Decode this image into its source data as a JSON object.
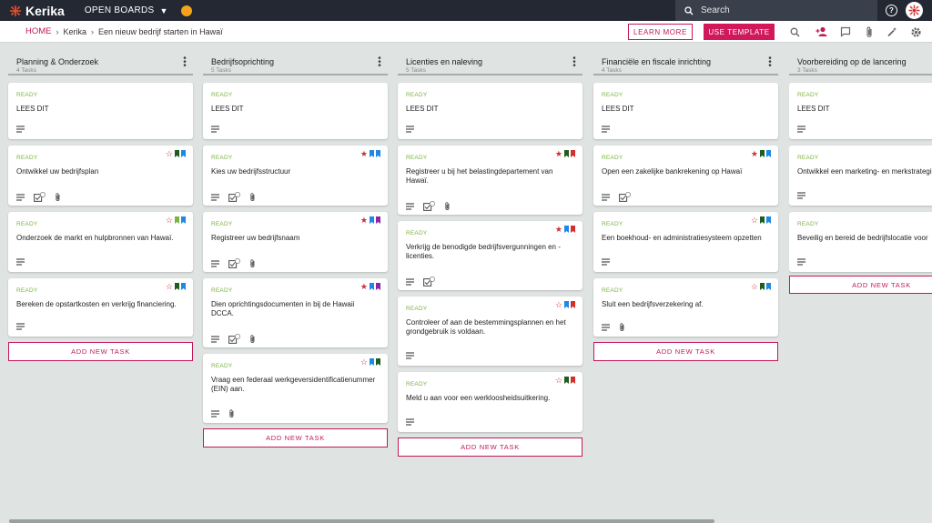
{
  "app": {
    "logo_text": "Kerika",
    "open_boards": "OPEN BOARDS"
  },
  "search": {
    "placeholder": "Search"
  },
  "help": {
    "symbol": "?"
  },
  "breadcrumb": {
    "home": "HOME",
    "kerika": "Kerika",
    "board": "Een nieuw bedrijf starten in Hawaï"
  },
  "buttons": {
    "learn_more": "LEARN MORE",
    "use_template": "USE TEMPLATE",
    "add_task": "ADD NEW TASK"
  },
  "colors": {
    "accent": "#c2185b",
    "ready": "#7cb342",
    "red": "#d32f2f",
    "green": "#1b5e20",
    "blue": "#1e88e5",
    "light_green": "#7cb342",
    "purple": "#8e24aa"
  },
  "columns": [
    {
      "title": "Planning & Onderzoek",
      "count": "4 Tasks",
      "cards": [
        {
          "status": "READY",
          "title": "LEES DIT",
          "icons": [
            "desc"
          ],
          "flags": []
        },
        {
          "status": "READY",
          "title": "Ontwikkel uw bedrijfsplan",
          "icons": [
            "desc",
            "checklist",
            "attach"
          ],
          "flags": [
            "star-outline",
            "green",
            "blue"
          ]
        },
        {
          "status": "READY",
          "title": "Onderzoek de markt en hulpbronnen van Hawaï.",
          "icons": [
            "desc"
          ],
          "flags": [
            "star-outline",
            "light_green",
            "blue"
          ]
        },
        {
          "status": "READY",
          "title": "Bereken de opstartkosten en verkrijg financiering.",
          "icons": [
            "desc"
          ],
          "flags": [
            "star-outline",
            "green",
            "blue"
          ]
        }
      ]
    },
    {
      "title": "Bedrijfsoprichting",
      "count": "5 Tasks",
      "cards": [
        {
          "status": "READY",
          "title": "LEES DIT",
          "icons": [
            "desc"
          ],
          "flags": []
        },
        {
          "status": "READY",
          "title": "Kies uw bedrijfsstructuur",
          "icons": [
            "desc",
            "checklist",
            "attach"
          ],
          "flags": [
            "star",
            "blue",
            "blue"
          ]
        },
        {
          "status": "READY",
          "title": "Registreer uw bedrijfsnaam",
          "icons": [
            "desc",
            "checklist",
            "attach"
          ],
          "flags": [
            "star",
            "blue",
            "purple"
          ]
        },
        {
          "status": "READY",
          "title": "Dien oprichtingsdocumenten in bij de Hawaii DCCA.",
          "icons": [
            "desc",
            "checklist",
            "attach"
          ],
          "flags": [
            "star",
            "blue",
            "purple"
          ]
        },
        {
          "status": "READY",
          "title": "Vraag een federaal werkgeversidentificatienummer (EIN) aan.",
          "icons": [
            "desc",
            "attach"
          ],
          "flags": [
            "star-outline",
            "blue",
            "green"
          ]
        }
      ]
    },
    {
      "title": "Licenties en naleving",
      "count": "5 Tasks",
      "cards": [
        {
          "status": "READY",
          "title": "LEES DIT",
          "icons": [
            "desc"
          ],
          "flags": []
        },
        {
          "status": "READY",
          "title": "Registreer u bij het belastingdepartement van Hawaï.",
          "icons": [
            "desc",
            "checklist",
            "attach"
          ],
          "flags": [
            "star",
            "green",
            "red"
          ]
        },
        {
          "status": "READY",
          "title": "Verkrijg de benodigde bedrijfsvergunningen en -licenties.",
          "icons": [
            "desc",
            "checklist"
          ],
          "flags": [
            "star",
            "blue",
            "red"
          ]
        },
        {
          "status": "READY",
          "title": "Controleer of aan de bestemmingsplannen en het grondgebruik is voldaan.",
          "icons": [
            "desc"
          ],
          "flags": [
            "star-outline",
            "blue",
            "red"
          ]
        },
        {
          "status": "READY",
          "title": "Meld u aan voor een werkloosheidsuitkering.",
          "icons": [
            "desc"
          ],
          "flags": [
            "star-outline",
            "green",
            "red"
          ]
        }
      ]
    },
    {
      "title": "Financiële en fiscale inrichting",
      "count": "4 Tasks",
      "cards": [
        {
          "status": "READY",
          "title": "LEES DIT",
          "icons": [
            "desc"
          ],
          "flags": []
        },
        {
          "status": "READY",
          "title": "Open een zakelijke bankrekening op Hawaï",
          "icons": [
            "desc",
            "checklist"
          ],
          "flags": [
            "star",
            "green",
            "blue"
          ]
        },
        {
          "status": "READY",
          "title": "Een boekhoud- en administratiesysteem opzetten",
          "icons": [
            "desc"
          ],
          "flags": [
            "star-outline",
            "green",
            "blue"
          ]
        },
        {
          "status": "READY",
          "title": "Sluit een bedrijfsverzekering af.",
          "icons": [
            "desc",
            "attach"
          ],
          "flags": [
            "star-outline",
            "green",
            "blue"
          ]
        }
      ]
    },
    {
      "title": "Voorbereiding op de lancering",
      "count": "3 Tasks",
      "cards": [
        {
          "status": "READY",
          "title": "LEES DIT",
          "icons": [
            "desc"
          ],
          "flags": []
        },
        {
          "status": "READY",
          "title": "Ontwikkel een marketing- en merkstrategie",
          "icons": [
            "desc"
          ],
          "flags": []
        },
        {
          "status": "READY",
          "title": "Beveilig en bereid de bedrijfslocatie voor",
          "icons": [
            "desc"
          ],
          "flags": []
        }
      ]
    }
  ],
  "checklist_badge": "0"
}
